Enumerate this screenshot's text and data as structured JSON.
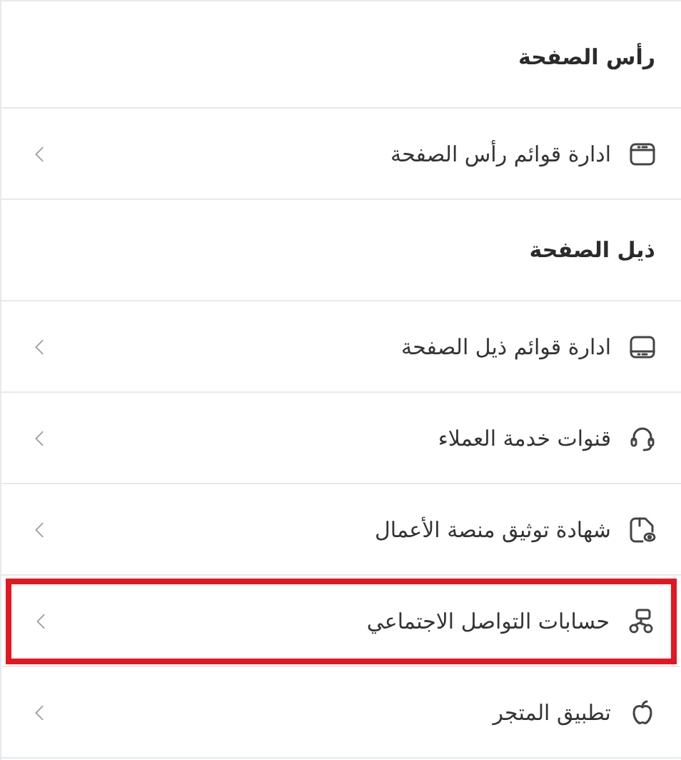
{
  "sections": [
    {
      "title": "رأس الصفحة",
      "items": [
        {
          "label": "ادارة قوائم رأس الصفحة",
          "highlighted": false
        }
      ]
    },
    {
      "title": "ذيل الصفحة",
      "items": [
        {
          "label": "ادارة قوائم ذيل الصفحة",
          "highlighted": false
        },
        {
          "label": "قنوات خدمة العملاء",
          "highlighted": false
        },
        {
          "label": "شهادة توثيق منصة الأعمال",
          "highlighted": false
        },
        {
          "label": "حسابات التواصل الاجتماعي",
          "highlighted": true
        },
        {
          "label": "تطبيق المتجر",
          "highlighted": false
        }
      ]
    }
  ]
}
